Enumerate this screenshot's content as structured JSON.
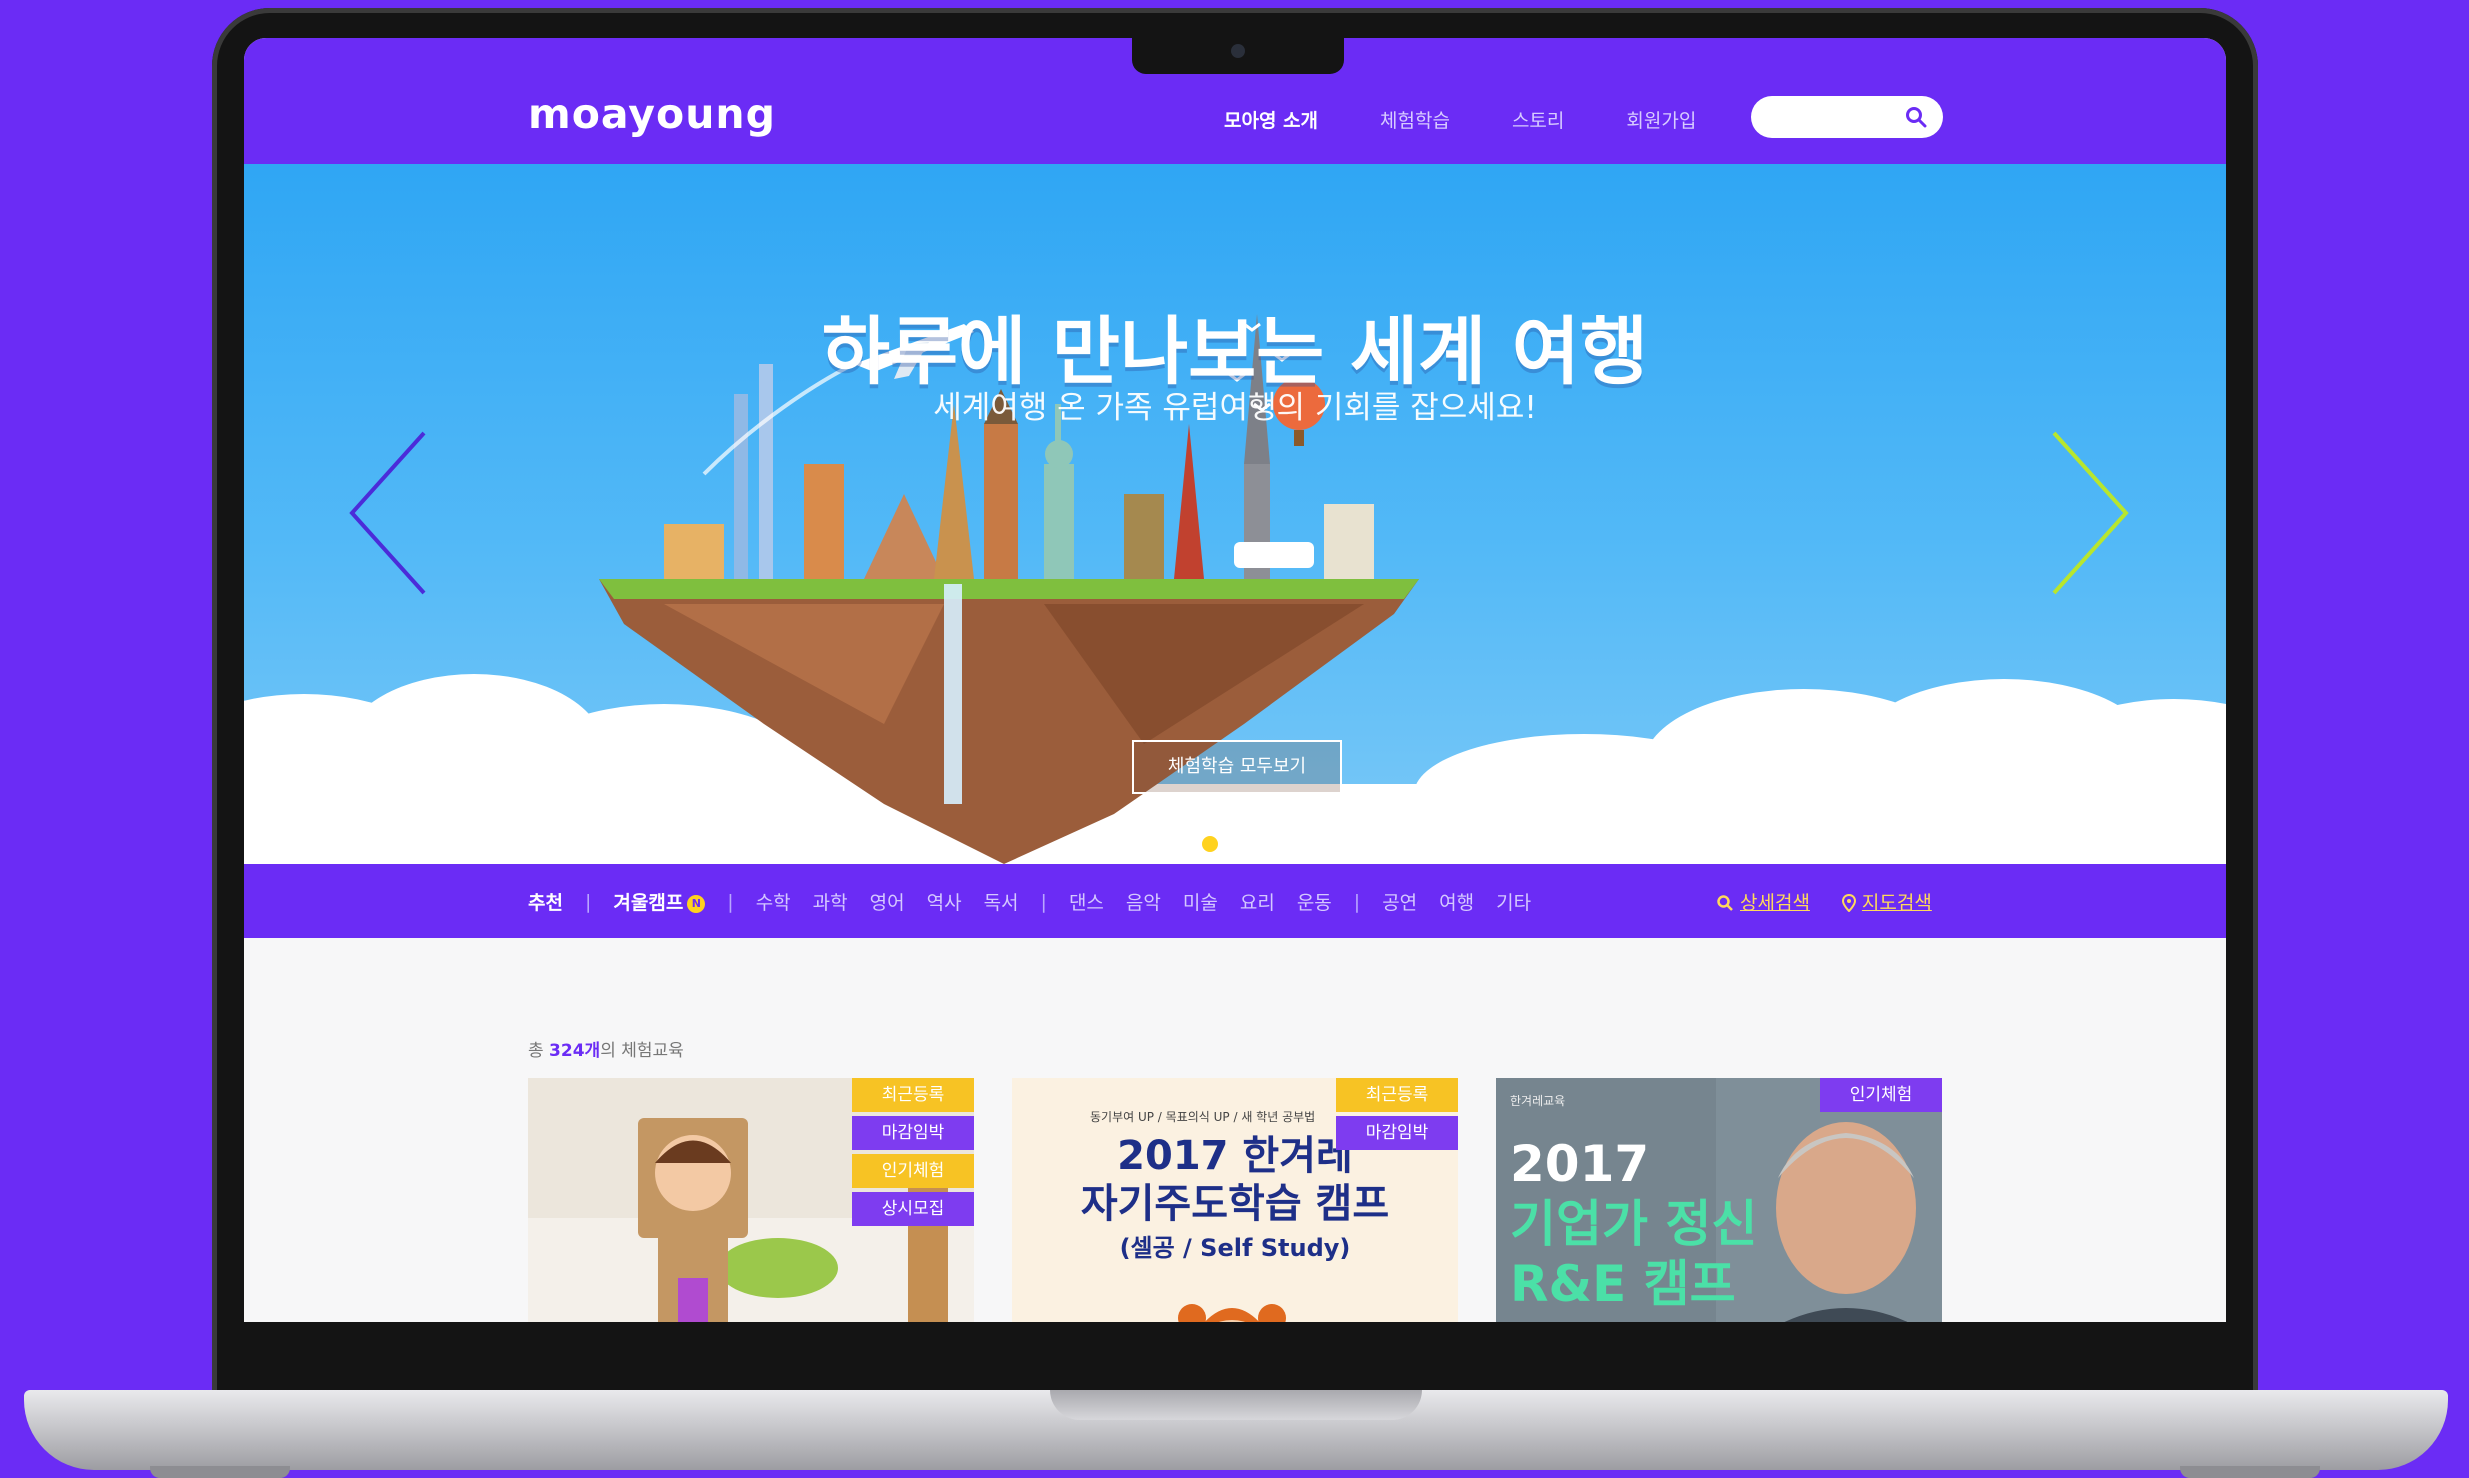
{
  "header": {
    "logo": "moayoung",
    "nav": [
      "모아영 소개",
      "체험학습",
      "스토리",
      "회원가입"
    ],
    "search_placeholder": ""
  },
  "hero": {
    "title": "하루에 만나보는 세계 여행",
    "subtitle": "세계여행 온 가족 유럽여행의 기회를 잡으세요!",
    "button_label": "체험학습 모두보기",
    "slide_count": 3,
    "active_slide": 1
  },
  "categories": {
    "recommend": "추천",
    "winter_camp": "겨울캠프",
    "new_badge": "N",
    "subjects_1": [
      "수학",
      "과학",
      "영어",
      "역사",
      "독서"
    ],
    "subjects_2": [
      "댄스",
      "음악",
      "미술",
      "요리",
      "운동"
    ],
    "subjects_3": [
      "공연",
      "여행",
      "기타"
    ],
    "detail_search": "상세검색",
    "map_search": "지도검색"
  },
  "listing": {
    "total_prefix": "총",
    "total_count": "324개",
    "total_suffix": "의 체험교육",
    "cards": [
      {
        "tags": [
          "최근등록",
          "마감임박",
          "인기체험",
          "상시모집"
        ]
      },
      {
        "tags": [
          "최근등록",
          "마감임박"
        ],
        "small_text": "동기부여 UP / 목표의식 UP / 새 학년 공부법",
        "title_line1": "2017 한겨레",
        "title_line2": "자기주도학습 캠프",
        "subtitle": "(셀공 / Self Study)"
      },
      {
        "tags": [
          "인기체험"
        ],
        "small_text": "한겨레교육",
        "title_line1": "2017",
        "title_line2": "기업가 정신",
        "title_line3": "R&E 캠프"
      }
    ]
  },
  "colors": {
    "brand_purple": "#6b2cf5",
    "accent_yellow": "#f7c324",
    "sky_blue": "#2fa6f4",
    "link_yellow": "#ffd95a"
  }
}
